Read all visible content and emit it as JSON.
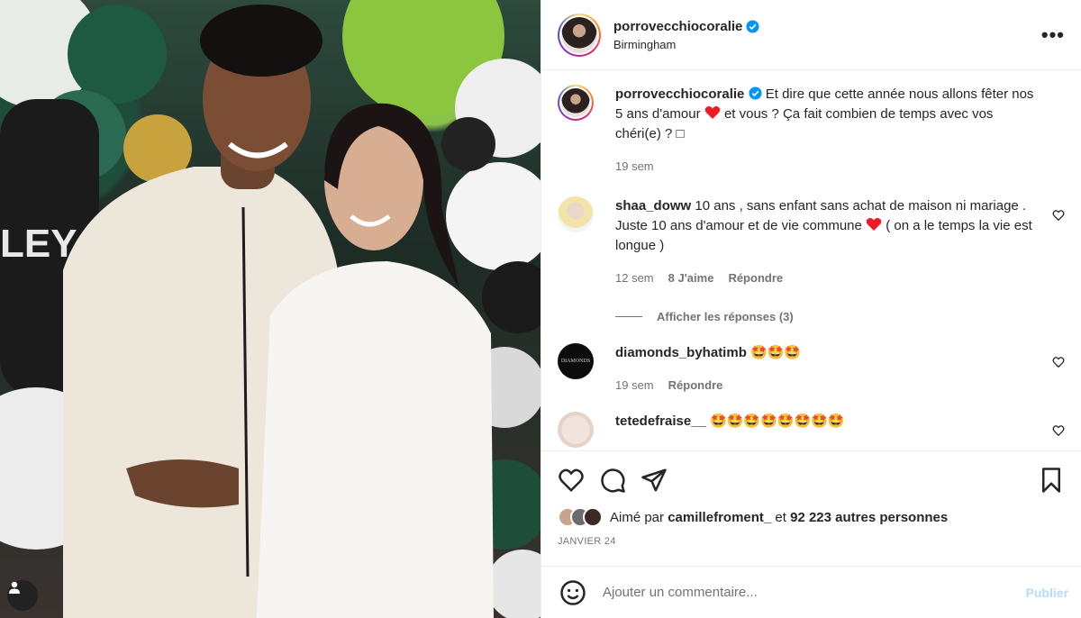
{
  "post": {
    "author": "porrovecchiocoralie",
    "location": "Birmingham",
    "caption": {
      "part1": "Et dire que cette année nous allons fêter nos 5 ans d'amour",
      "part2": "et vous ? Ça fait combien de temps avec vos chéri(e) ? ",
      "part3": "□",
      "time": "19 sem"
    },
    "more_label": "•••",
    "photo_sign_text": "LEY"
  },
  "comments": [
    {
      "user": "shaa_doww",
      "text_a": "10 ans , sans enfant sans achat de maison ni mariage . Juste 10 ans d'amour et de vie commune",
      "text_b": "( on a le temps la vie est longue )",
      "time": "12 sem",
      "likes": "8 J'aime",
      "reply": "Répondre",
      "view_replies": "Afficher les réponses (3)"
    },
    {
      "user": "diamonds_byhatimb",
      "emojis": "🤩🤩🤩",
      "time": "19 sem",
      "reply": "Répondre",
      "avatar_text": "DIAMONDS"
    },
    {
      "user": "tetedefraise__",
      "emojis": "🤩🤩🤩🤩🤩🤩🤩🤩"
    }
  ],
  "likes": {
    "prefix": "Aimé par",
    "user": "camillefroment_",
    "connector": "et",
    "count": "92 223 autres personnes"
  },
  "date": "JANVIER 24",
  "add_comment": {
    "placeholder": "Ajouter un commentaire...",
    "publish": "Publier"
  },
  "icons": {
    "like": "heart-icon",
    "comment": "comment-icon",
    "share": "send-icon",
    "save": "bookmark-icon",
    "emoji": "smiley-icon",
    "tag": "user-tag-icon"
  },
  "colors": {
    "verified": "#0095f6",
    "heart_red": "#ed1c24",
    "publish": "#b3dbff"
  }
}
